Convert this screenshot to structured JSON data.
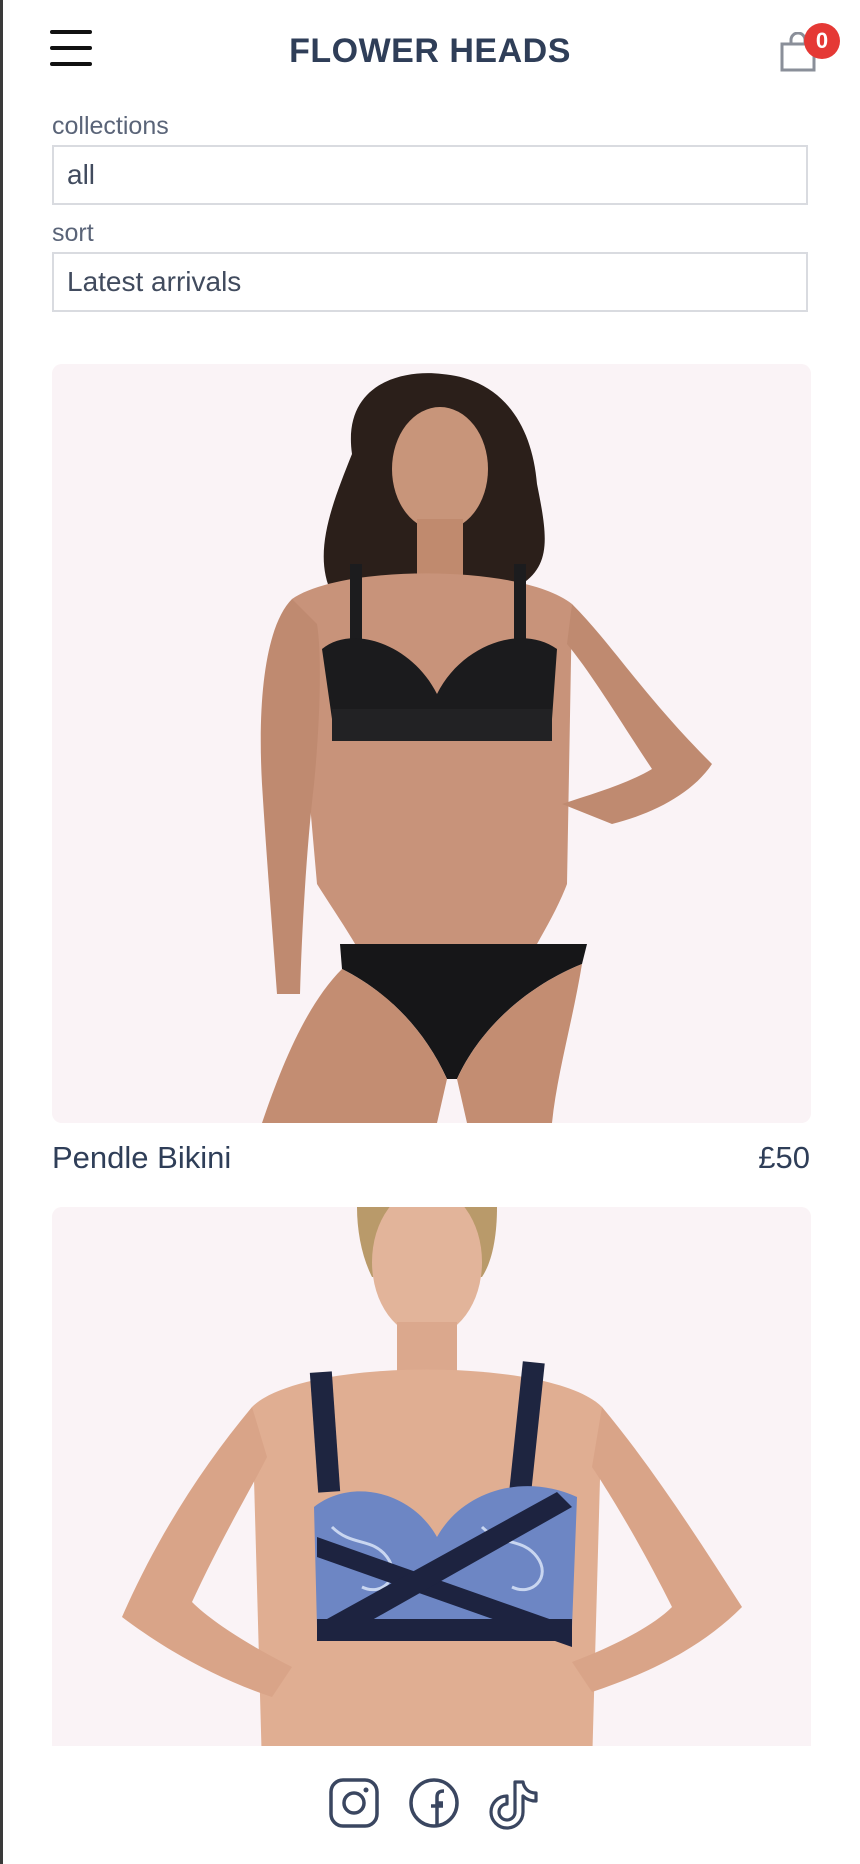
{
  "header": {
    "brand": "FLOWER HEADS",
    "cart_count": "0",
    "menu_icon": "hamburger-icon",
    "cart_icon": "shopping-bag-icon"
  },
  "filters": {
    "collections_label": "collections",
    "collections_value": "all",
    "sort_label": "sort",
    "sort_value": "Latest arrivals"
  },
  "products": [
    {
      "name": "Pendle Bikini",
      "price": "£50",
      "image": "model-wearing-black-bikini"
    },
    {
      "name": "",
      "price": "",
      "image": "model-wearing-navy-paisley-crossover-bikini"
    }
  ],
  "footer": {
    "social": [
      "instagram-icon",
      "facebook-icon",
      "tiktok-icon"
    ]
  },
  "colors": {
    "brand_text": "#2f3e58",
    "badge": "#e53935",
    "image_bg": "#faf3f6"
  }
}
